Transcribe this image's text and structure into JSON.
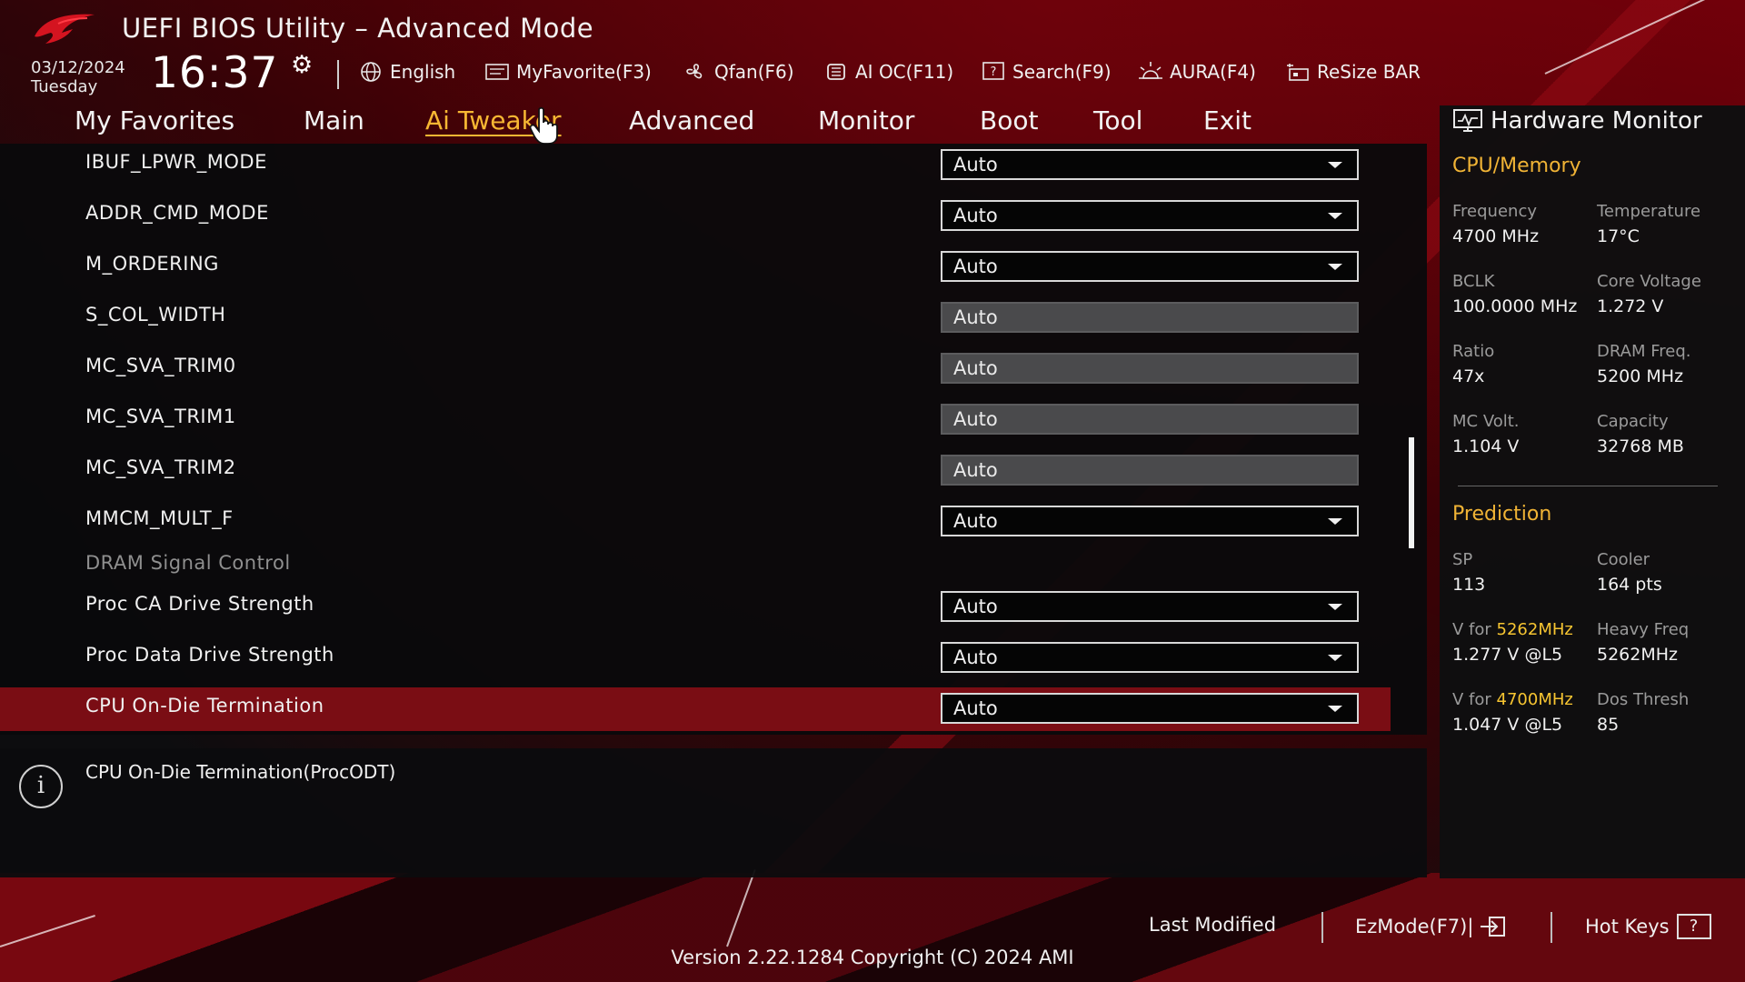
{
  "header": {
    "title": "UEFI BIOS Utility – Advanced Mode",
    "date": "03/12/2024",
    "day": "Tuesday",
    "time": "16:37",
    "tools": [
      {
        "label": "English",
        "icon": "globe-icon"
      },
      {
        "label": "MyFavorite(F3)",
        "icon": "favorite-icon"
      },
      {
        "label": "Qfan(F6)",
        "icon": "fan-icon"
      },
      {
        "label": "AI OC(F11)",
        "icon": "ai-chip-icon"
      },
      {
        "label": "Search(F9)",
        "icon": "search-help-icon"
      },
      {
        "label": "AURA(F4)",
        "icon": "aura-light-icon"
      },
      {
        "label": "ReSize BAR",
        "icon": "resize-bar-icon"
      }
    ]
  },
  "tabs": [
    {
      "label": "My Favorites"
    },
    {
      "label": "Main"
    },
    {
      "label": "Ai Tweaker",
      "active": true
    },
    {
      "label": "Advanced"
    },
    {
      "label": "Monitor"
    },
    {
      "label": "Boot"
    },
    {
      "label": "Tool"
    },
    {
      "label": "Exit"
    }
  ],
  "settings": [
    {
      "label": "IBUF_LPWR_MODE",
      "value": "Auto",
      "type": "dropdown"
    },
    {
      "label": "ADDR_CMD_MODE",
      "value": "Auto",
      "type": "dropdown"
    },
    {
      "label": "M_ORDERING",
      "value": "Auto",
      "type": "dropdown"
    },
    {
      "label": "S_COL_WIDTH",
      "value": "Auto",
      "type": "input"
    },
    {
      "label": "MC_SVA_TRIM0",
      "value": "Auto",
      "type": "input"
    },
    {
      "label": "MC_SVA_TRIM1",
      "value": "Auto",
      "type": "input"
    },
    {
      "label": "MC_SVA_TRIM2",
      "value": "Auto",
      "type": "input"
    },
    {
      "label": "MMCM_MULT_F",
      "value": "Auto",
      "type": "dropdown"
    },
    {
      "label": "DRAM Signal Control",
      "type": "section"
    },
    {
      "label": "Proc CA Drive Strength",
      "value": "Auto",
      "type": "dropdown"
    },
    {
      "label": "Proc Data Drive Strength",
      "value": "Auto",
      "type": "dropdown"
    },
    {
      "label": "CPU On-Die Termination",
      "value": "Auto",
      "type": "dropdown",
      "selected": true
    }
  ],
  "help": {
    "text": "CPU On-Die Termination(ProcODT)"
  },
  "hardware_monitor": {
    "title": "Hardware Monitor",
    "cpu_memory": {
      "heading": "CPU/Memory",
      "frequency_label": "Frequency",
      "frequency": "4700 MHz",
      "temperature_label": "Temperature",
      "temperature": "17°C",
      "bclk_label": "BCLK",
      "bclk": "100.0000 MHz",
      "core_voltage_label": "Core Voltage",
      "core_voltage": "1.272 V",
      "ratio_label": "Ratio",
      "ratio": "47x",
      "dram_freq_label": "DRAM Freq.",
      "dram_freq": "5200 MHz",
      "mc_volt_label": "MC Volt.",
      "mc_volt": "1.104 V",
      "capacity_label": "Capacity",
      "capacity": "32768 MB"
    },
    "prediction": {
      "heading": "Prediction",
      "sp_label": "SP",
      "sp": "113",
      "cooler_label": "Cooler",
      "cooler": "164 pts",
      "v_for_label": "V for",
      "v_high_freq": "5262MHz",
      "v_high": "1.277 V @L5",
      "heavy_freq_label": "Heavy Freq",
      "heavy_freq": "5262MHz",
      "v_low_freq": "4700MHz",
      "v_low": "1.047 V @L5",
      "dos_thresh_label": "Dos Thresh",
      "dos_thresh": "85"
    }
  },
  "footer": {
    "last_modified": "Last Modified",
    "ezmode": "EzMode(F7)|",
    "hot_keys": "Hot Keys",
    "hot_keys_glyph": "?",
    "version": "Version 2.22.1284 Copyright (C) 2024 AMI"
  },
  "colors": {
    "accent": "#f7b733",
    "selected_row": "#7a0d14",
    "background_red": "#8c0a14",
    "panel": "#0b0b0c"
  }
}
